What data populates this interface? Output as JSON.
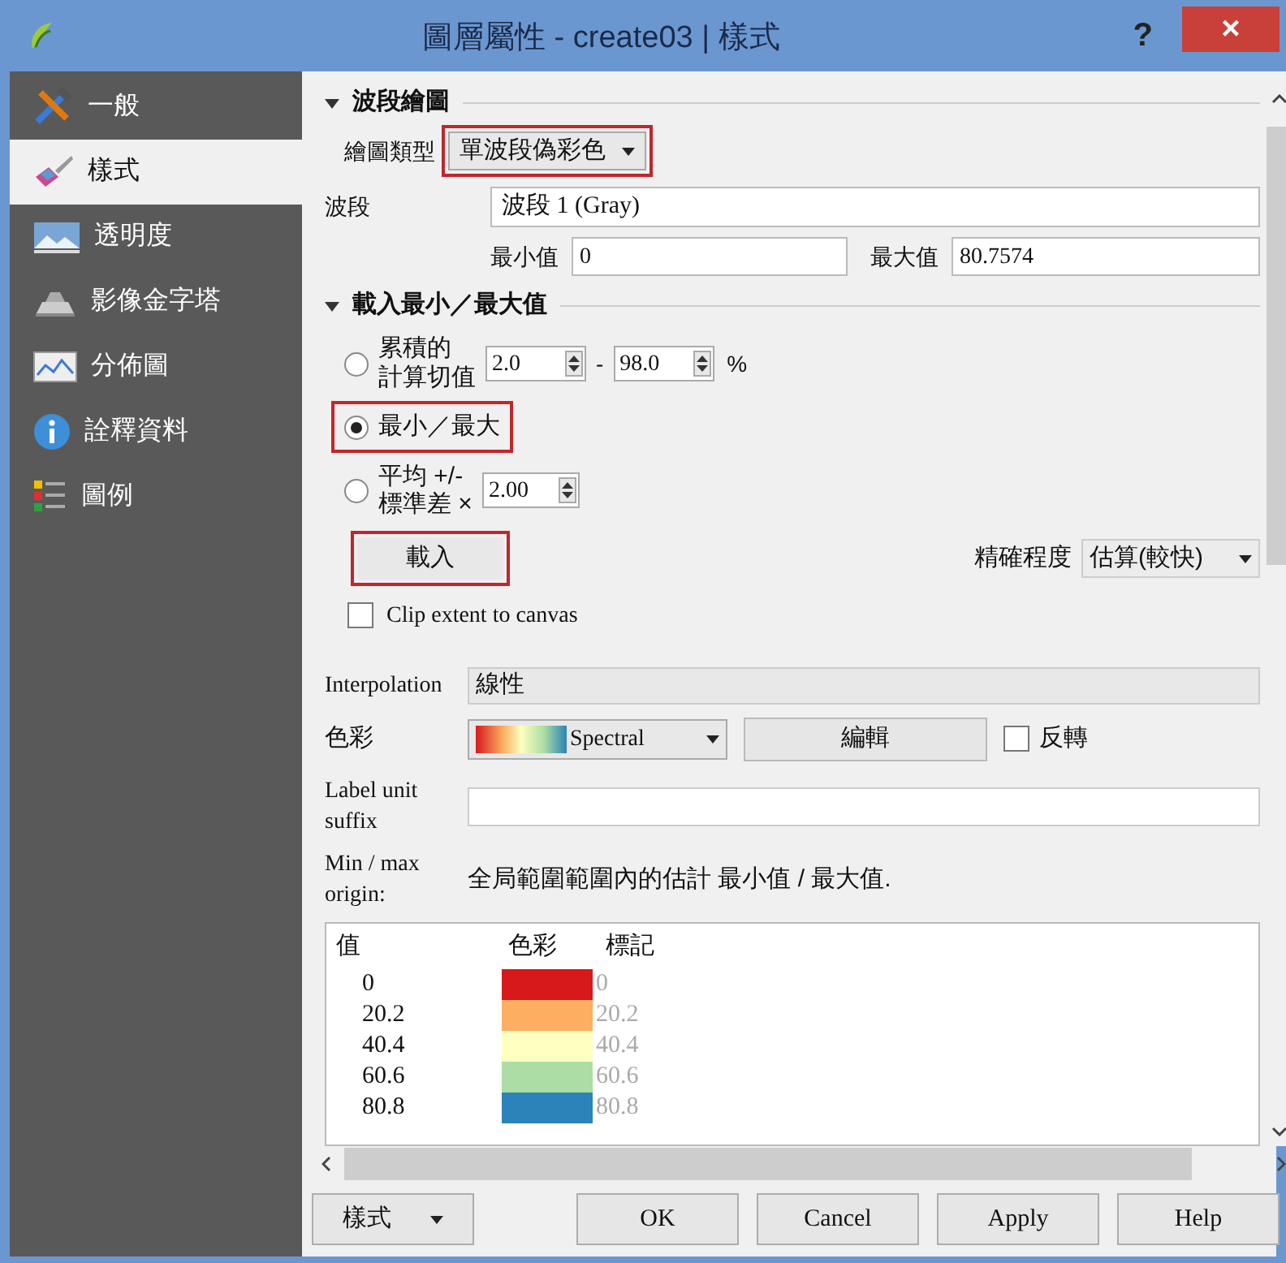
{
  "window": {
    "title": "圖層屬性 - create03 | 樣式",
    "help": "?",
    "close": "×"
  },
  "sidebar": {
    "items": [
      {
        "label": "一般",
        "selected": false
      },
      {
        "label": "樣式",
        "selected": true
      },
      {
        "label": "透明度",
        "selected": false
      },
      {
        "label": "影像金字塔",
        "selected": false
      },
      {
        "label": "分佈圖",
        "selected": false
      },
      {
        "label": "詮釋資料",
        "selected": false
      },
      {
        "label": "圖例",
        "selected": false
      }
    ]
  },
  "band_rendering": {
    "title": "波段繪圖",
    "expanded": true,
    "render_type_label": "繪圖類型",
    "render_type": "單波段偽彩色",
    "render_type_highlighted": true,
    "band_label": "波段",
    "band": "波段 1 (Gray)",
    "min_label": "最小值",
    "min": "0",
    "max_label": "最大值",
    "max": "80.7574"
  },
  "load_min_max": {
    "title": "載入最小／最大值",
    "expanded": true,
    "options": [
      {
        "kind": "cumulative",
        "label_1": "累積的",
        "label_2": "計算切值",
        "from": "2.0",
        "dash": "-",
        "to": "98.0",
        "unit": "%",
        "selected": false
      },
      {
        "kind": "minmax",
        "label": "最小／最大",
        "selected": true,
        "highlighted": true
      },
      {
        "kind": "stddev",
        "label_1": "平均 +/-",
        "label_2": "標準差 ×",
        "value": "2.00",
        "selected": false
      }
    ],
    "load_button": "載入",
    "load_highlighted": true,
    "accuracy_label": "精確程度",
    "accuracy": "估算(較快)",
    "clip_label": "Clip extent to canvas",
    "clip_checked": false
  },
  "interpolation_label": "Interpolation",
  "interpolation": "線性",
  "color_label": "色彩",
  "color_ramp": "Spectral",
  "edit_button": "編輯",
  "invert_label": "反轉",
  "invert_checked": false,
  "label_unit_label_1": "Label unit",
  "label_unit_label_2": "suffix",
  "origin_label_1": "Min / max",
  "origin_label_2": "origin:",
  "origin_text": "全局範圍範圍內的估計 最小值 / 最大值.",
  "table": {
    "columns": [
      "值",
      "色彩",
      "標記"
    ],
    "rows": [
      {
        "value": "0",
        "color": "#d7191c",
        "label": "0"
      },
      {
        "value": "20.2",
        "color": "#fdae61",
        "label": "20.2"
      },
      {
        "value": "40.4",
        "color": "#ffffbf",
        "label": "40.4"
      },
      {
        "value": "60.6",
        "color": "#abdda4",
        "label": "60.6"
      },
      {
        "value": "80.8",
        "color": "#2b83ba",
        "label": "80.8"
      }
    ]
  },
  "buttons": {
    "style": "樣式",
    "ok": "OK",
    "cancel": "Cancel",
    "apply": "Apply",
    "help": "Help"
  }
}
